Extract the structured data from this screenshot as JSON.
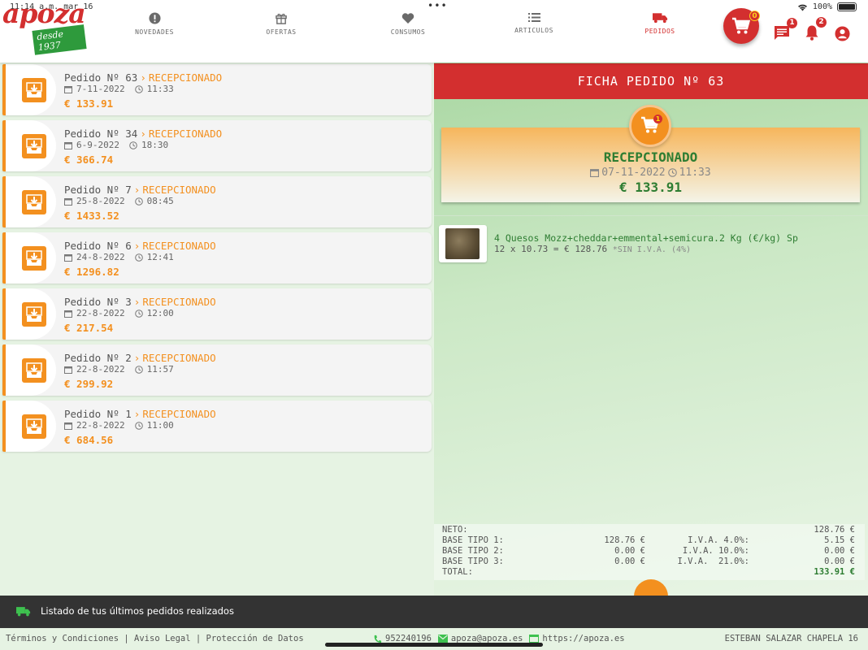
{
  "status_bar": {
    "time": "11:14 a.m.",
    "date": "mar 16",
    "battery": "100%"
  },
  "logo": {
    "text": "apoza",
    "badge": "desde 1937"
  },
  "nav": [
    {
      "id": "novedades",
      "label": "NOVEDADES",
      "icon": "alert-icon"
    },
    {
      "id": "ofertas",
      "label": "OFERTAS",
      "icon": "gift-icon"
    },
    {
      "id": "consumos",
      "label": "CONSUMOS",
      "icon": "heart-icon"
    },
    {
      "id": "articulos",
      "label": "ARTICULOS",
      "icon": "list-icon"
    },
    {
      "id": "pedidos",
      "label": "PEDIDOS",
      "icon": "truck-icon",
      "active": true
    }
  ],
  "header_actions": {
    "cart_count": "0",
    "messages_count": "1",
    "notifications_count": "2"
  },
  "orders": [
    {
      "label": "Pedido Nº 63",
      "status": "RECEPCIONADO",
      "date": "7-11-2022",
      "time": "11:33",
      "amount": "€ 133.91"
    },
    {
      "label": "Pedido Nº 34",
      "status": "RECEPCIONADO",
      "date": "6-9-2022",
      "time": "18:30",
      "amount": "€ 366.74"
    },
    {
      "label": "Pedido Nº 7",
      "status": "RECEPCIONADO",
      "date": "25-8-2022",
      "time": "08:45",
      "amount": "€ 1433.52"
    },
    {
      "label": "Pedido Nº 6",
      "status": "RECEPCIONADO",
      "date": "24-8-2022",
      "time": "12:41",
      "amount": "€ 1296.82"
    },
    {
      "label": "Pedido Nº 3",
      "status": "RECEPCIONADO",
      "date": "22-8-2022",
      "time": "12:00",
      "amount": "€ 217.54"
    },
    {
      "label": "Pedido Nº 2",
      "status": "RECEPCIONADO",
      "date": "22-8-2022",
      "time": "11:57",
      "amount": "€ 299.92"
    },
    {
      "label": "Pedido Nº 1",
      "status": "RECEPCIONADO",
      "date": "22-8-2022",
      "time": "11:00",
      "amount": "€ 684.56"
    }
  ],
  "ficha": {
    "title": "FICHA PEDIDO Nº 63",
    "cart_badge": "1",
    "status": "RECEPCIONADO",
    "date": "07-11-2022",
    "time": "11:33",
    "total": "€ 133.91",
    "item": {
      "name": "4 Quesos Mozz+cheddar+emmental+semicura.2 Kg (€/kg) Sp",
      "calc": "12 x 10.73 = € 128.76",
      "iva": "*SIN I.V.A. (4%)"
    },
    "totals": {
      "neto_label": "NETO:",
      "neto": "128.76 €",
      "b1_label": "BASE TIPO 1:",
      "b1": "128.76 €",
      "i1_label": "I.V.A. 4.0%:",
      "i1": "5.15 €",
      "b2_label": "BASE TIPO 2:",
      "b2": "0.00 €",
      "i2_label": "I.V.A. 10.0%:",
      "i2": "0.00 €",
      "b3_label": "BASE TIPO 3:",
      "b3": "0.00 €",
      "i3_label": "I.V.A.  21.0%:",
      "i3": "0.00 €",
      "total_label": "TOTAL:",
      "total": "133.91 €"
    }
  },
  "info_bar": "Listado de tus últimos pedidos realizados",
  "footer": {
    "links": "Términos y Condiciones | Aviso Legal | Protección de Datos",
    "phone": "952240196",
    "email": "apoza@apoza.es",
    "web": "https://apoza.es",
    "user": "ESTEBAN SALAZAR CHAPELA 16"
  },
  "colors": {
    "brand_red": "#d32f2f",
    "orange": "#f3901f",
    "green": "#2e7d32"
  }
}
